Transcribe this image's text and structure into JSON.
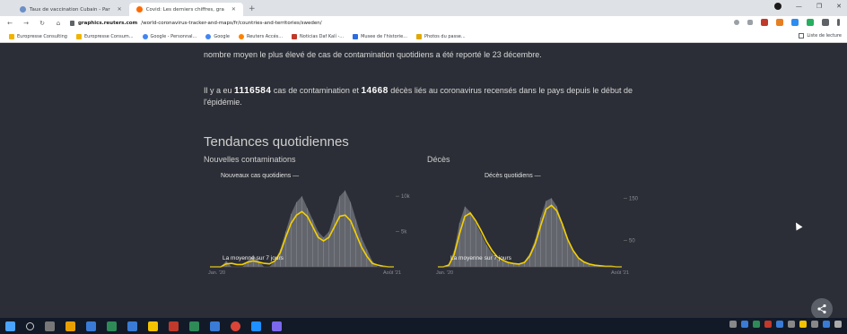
{
  "browser": {
    "tabs": [
      {
        "label": "Taux de vaccination Cubain - Par",
        "active": false
      },
      {
        "label": "Covid: Les derniers chiffres, gra",
        "active": true
      }
    ],
    "new_tab": "+",
    "url_prefix": "graphics.reuters.com",
    "url_rest": "/world-coronavirus-tracker-and-maps/fr/countries-and-territories/sweden/",
    "bookmarks": [
      "Europresse Consulting",
      "Europresse Consum...",
      "Google - Personnal...",
      "Google",
      "Reuters Accés...",
      "Noticias Daf Kalí -...",
      "Musee de l'historie...",
      "Photos du passe..."
    ],
    "bookmarks_right": "Liste de lecture",
    "colors": {
      "tab_bg": "#dee1e6",
      "active_tab": "#ffffff",
      "toolbar": "#ffffff"
    }
  },
  "article": {
    "para1": "nombre moyen le plus élevé de cas de contamination quotidiens a été reporté le 23 décembre.",
    "para2_pre": "Il y a eu",
    "cases_total": "1116584",
    "para2_mid": "cas de contamination et",
    "deaths_total": "14668",
    "para2_post": "décès liés au coronavirus recensés dans le pays depuis le début de l'épidémie.",
    "section_title": "Tendances quotidiennes"
  },
  "charts": {
    "left_title": "Nouvelles contaminations",
    "right_title": "Décès",
    "left_legend": "Nouveaux cas quotidiens —",
    "right_legend": "Décès quotidiens —",
    "avg_label": "La moyenne sur 7 jours",
    "left_ticks": [
      "10k",
      "5k"
    ],
    "right_ticks": [
      "150",
      "50"
    ],
    "x_start": "Jan. '20",
    "x_end": "Août '21"
  },
  "chart_data": [
    {
      "type": "area",
      "title": "Nouvelles contaminations",
      "y_ticks": [
        "10k",
        "5k"
      ],
      "x_ticks": [
        "Jan. '20",
        "Août '21"
      ],
      "series": [
        {
          "name": "Nouveaux cas quotidiens",
          "values": [
            0,
            0,
            0,
            1,
            0,
            0,
            0,
            1,
            2,
            1,
            0,
            0,
            1,
            3,
            6,
            9,
            11,
            12,
            10,
            8,
            6,
            5,
            6,
            9,
            12,
            13,
            11,
            8,
            5,
            3,
            1,
            0,
            0,
            0,
            0
          ]
        },
        {
          "name": "La moyenne sur 7 jours",
          "values": [
            0,
            0,
            0,
            0.5,
            0.6,
            0.4,
            0.4,
            0.8,
            1,
            0.8,
            0.6,
            0.5,
            1,
            2.4,
            5,
            7.4,
            8.8,
            9.4,
            8.6,
            6.8,
            5,
            4.4,
            5,
            6.8,
            8.6,
            8.8,
            7.8,
            5.6,
            3.4,
            1.8,
            0.6,
            0.3,
            0.1,
            0,
            0
          ]
        }
      ],
      "colors": {
        "avg_line": "#f5d000",
        "area": "#6c6f76"
      }
    },
    {
      "type": "area",
      "title": "Décès",
      "y_ticks": [
        "150",
        "50"
      ],
      "x_ticks": [
        "Jan. '20",
        "Août '21"
      ],
      "series": [
        {
          "name": "Décès quotidiens",
          "values": [
            0,
            0,
            5,
            30,
            80,
            110,
            100,
            80,
            60,
            40,
            25,
            15,
            10,
            8,
            6,
            5,
            10,
            25,
            50,
            90,
            120,
            125,
            110,
            80,
            50,
            30,
            15,
            8,
            5,
            3,
            2,
            1,
            1,
            0,
            0
          ]
        },
        {
          "name": "La moyenne sur 7 jours",
          "values": [
            0,
            0,
            3,
            22,
            60,
            92,
            98,
            84,
            66,
            46,
            30,
            18,
            12,
            8,
            6,
            5,
            8,
            20,
            42,
            75,
            105,
            112,
            102,
            78,
            50,
            30,
            16,
            9,
            5,
            3,
            2,
            1,
            1,
            0,
            0
          ]
        }
      ],
      "colors": {
        "avg_line": "#f5d000",
        "area": "#6c6f76"
      }
    }
  ],
  "share_icon": "share-icon"
}
